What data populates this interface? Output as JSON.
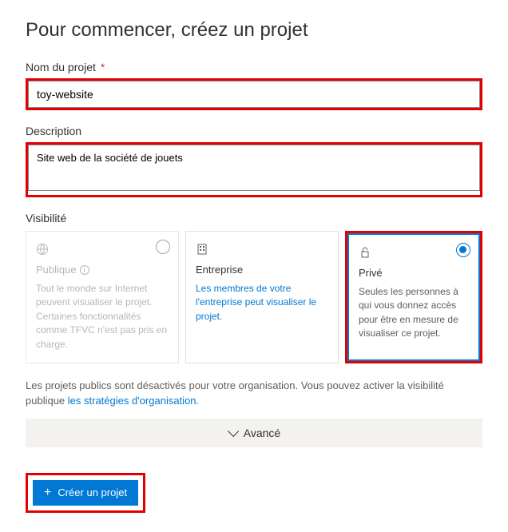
{
  "heading": "Pour commencer, créez un projet",
  "fields": {
    "projectName": {
      "label": "Nom du projet",
      "value": "toy-website",
      "required": "*"
    },
    "description": {
      "label": "Description",
      "value": "Site web de la société de jouets"
    }
  },
  "visibility": {
    "label": "Visibilité",
    "options": {
      "public": {
        "title": "Publique",
        "desc": "Tout le monde sur Internet peuvent visualiser le projet. Certaines fonctionnalités comme TFVC n'est pas pris en charge."
      },
      "enterprise": {
        "title": "Entreprise",
        "desc": "Les membres de votre l'entreprise peut visualiser le projet."
      },
      "private": {
        "title": "Privé",
        "desc": "Seules les personnes à qui vous donnez accès pour être en mesure de visualiser ce projet."
      }
    }
  },
  "notice": {
    "text": "Les projets publics sont désactivés pour votre organisation. Vous pouvez activer la visibilité publique",
    "link": "les stratégies d'organisation."
  },
  "advanced": {
    "label": "Avancé"
  },
  "createButton": {
    "label": "Créer un projet"
  }
}
